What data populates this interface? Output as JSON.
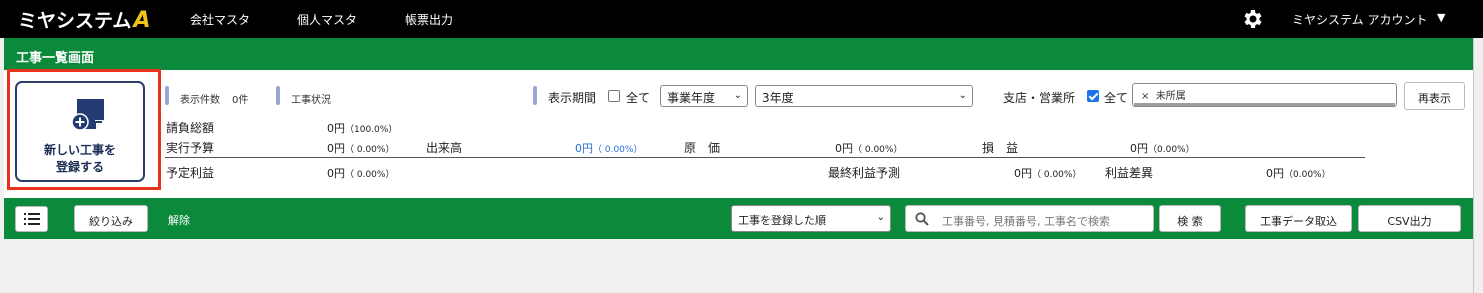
{
  "app": {
    "logo_text": "ミヤシステム",
    "logo_mark": "A",
    "nav": [
      "会社マスタ",
      "個人マスタ",
      "帳票出力"
    ],
    "account_name": "ミヤシステム アカウント",
    "account_caret": "▼",
    "settings_icon": "gear-icon"
  },
  "page": {
    "title": "工事一覧画面"
  },
  "new_button": {
    "icon": "new-document-plus-icon",
    "line1": "新しい工事を",
    "line2": "登録する"
  },
  "filters": {
    "count_label": "表示件数",
    "count_value": "0件",
    "status_label": "工事状況",
    "period_label": "表示期間",
    "period_all_label": "全て",
    "period_all_checked": false,
    "year_type_select": "事業年度",
    "year_select": "3年度",
    "branch_label": "支店・営業所",
    "branch_all_label": "全て",
    "branch_all_checked": true,
    "branch_tag_remove": "×",
    "branch_tag": "未所属",
    "refresh_button": "再表示"
  },
  "summary": {
    "contract_total": {
      "label": "請負総額",
      "value": "0円",
      "pct": "（100.0%）"
    },
    "execution_budget": {
      "label": "実行予算",
      "value": "0円",
      "pct": "（  0.00%）"
    },
    "progress_amount": {
      "label": "出来高",
      "value": "0円",
      "pct": "（  0.00%）"
    },
    "cost": {
      "label": "原　価",
      "value": "0円",
      "pct": "（  0.00%）"
    },
    "profit_loss": {
      "label": "損　益",
      "value": "0円",
      "pct": "（0.00%）"
    },
    "planned_profit": {
      "label": "予定利益",
      "value": "0円",
      "pct": "（  0.00%）"
    },
    "final_profit_forecast": {
      "label": "最終利益予測",
      "value": "0円",
      "pct": "（  0.00%）"
    },
    "profit_difference": {
      "label": "利益差異",
      "value": "0円",
      "pct": "（0.00%）"
    }
  },
  "toolbar": {
    "list_icon": "list-icon",
    "filter_button": "絞り込み",
    "clear_link": "解除",
    "sort_select": "工事を登録した順",
    "search_placeholder": "工事番号, 見積番号, 工事名で検索",
    "search_button": "検 索",
    "import_button": "工事データ取込",
    "csv_button": "CSV出力"
  },
  "colors": {
    "topbar": "#000000",
    "brand_green": "#0a8a3a",
    "logo_accent": "#f0c419",
    "highlight_red": "#e8321e",
    "link_blue": "#2a6fd6"
  }
}
